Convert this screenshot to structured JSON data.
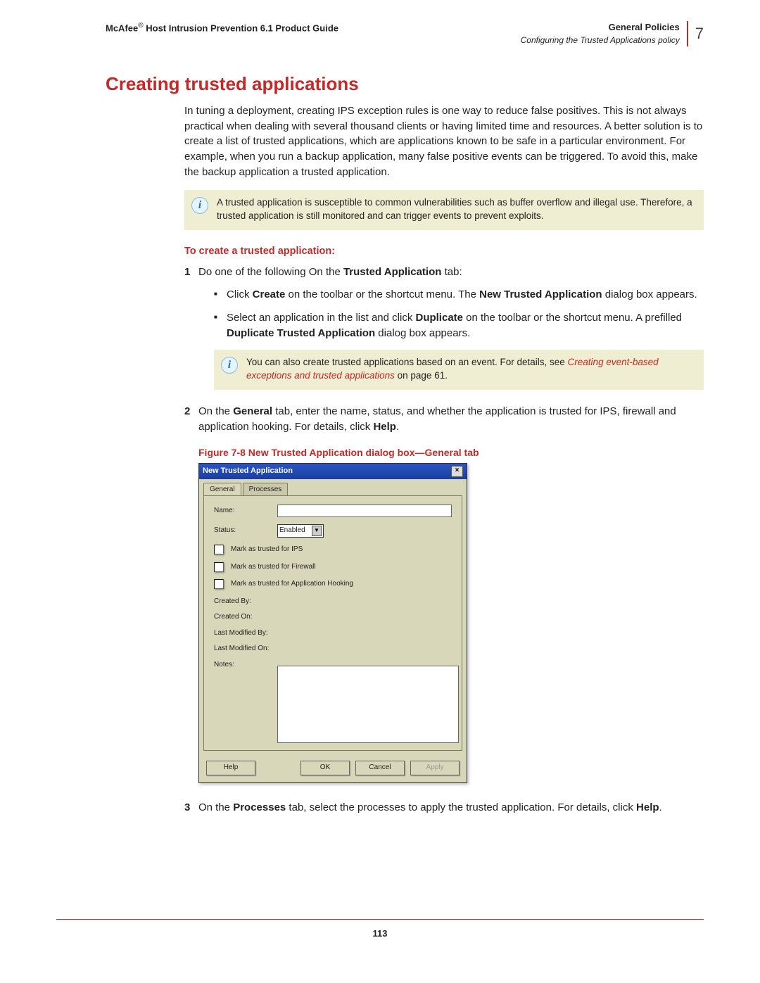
{
  "header": {
    "left_prefix": "McAfee",
    "left_suffix": " Host Intrusion Prevention 6.1 Product Guide",
    "right_top": "General Policies",
    "right_sub": "Configuring the Trusted Applications policy",
    "chapter": "7"
  },
  "section_title": "Creating trusted applications",
  "intro": "In tuning a deployment, creating IPS exception rules is one way to reduce false positives. This is not always practical when dealing with several thousand clients or having limited time and resources. A better solution is to create a list of trusted applications, which are applications known to be safe in a particular environment. For example, when you run a backup application, many false positive events can be triggered. To avoid this, make the backup application a trusted application.",
  "note1": "A trusted application is susceptible to common vulnerabilities such as buffer overflow and illegal use. Therefore, a trusted application is still monitored and can trigger events to prevent exploits.",
  "proc_heading": "To create a trusted application:",
  "step1": {
    "lead_a": "Do one of the following On the ",
    "bold_a": "Trusted Application",
    "lead_b": " tab:",
    "b1_a": "Click ",
    "b1_bold1": "Create",
    "b1_b": " on the toolbar or the shortcut menu. The ",
    "b1_bold2": "New Trusted Application",
    "b1_c": " dialog box appears.",
    "b2_a": "Select an application in the list and click ",
    "b2_bold1": "Duplicate",
    "b2_b": " on the toolbar or the shortcut menu. A prefilled ",
    "b2_bold2": "Duplicate Trusted Application",
    "b2_c": " dialog box appears."
  },
  "note2_a": "You can also create trusted applications based on an event. For details, see ",
  "note2_link": "Creating event-based exceptions and trusted applications",
  "note2_b": " on page 61.",
  "step2_a": "On the ",
  "step2_bold1": "General",
  "step2_b": " tab, enter the name, status, and whether the application is trusted for IPS, firewall and application hooking. For details, click ",
  "step2_bold2": "Help",
  "step2_c": ".",
  "figure_caption": "Figure 7-8  New Trusted Application dialog box—General tab",
  "dialog": {
    "title": "New Trusted Application",
    "tab_general": "General",
    "tab_processes": "Processes",
    "name": "Name:",
    "status": "Status:",
    "status_value": "Enabled",
    "chk_ips": "Mark as trusted for IPS",
    "chk_fw": "Mark as trusted for Firewall",
    "chk_ah": "Mark as trusted for Application Hooking",
    "created_by": "Created By:",
    "created_on": "Created On:",
    "mod_by": "Last Modified By:",
    "mod_on": "Last Modified On:",
    "notes": "Notes:",
    "btn_help": "Help",
    "btn_ok": "OK",
    "btn_cancel": "Cancel",
    "btn_apply": "Apply"
  },
  "step3_a": "On the ",
  "step3_bold1": "Processes",
  "step3_b": " tab, select the processes to apply the trusted application. For details, click ",
  "step3_bold2": "Help",
  "step3_c": ".",
  "page_number": "113"
}
